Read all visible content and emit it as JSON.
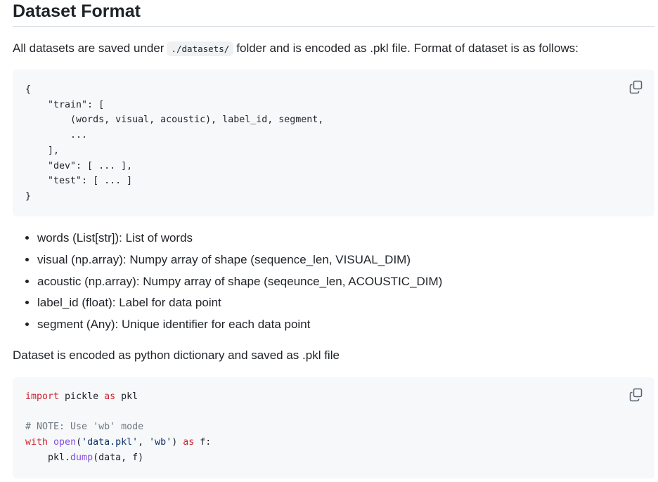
{
  "heading": "Dataset Format",
  "intro": {
    "before": "All datasets are saved under",
    "path": "./datasets/",
    "after": "folder and is encoded as .pkl file. Format of dataset is as follows:"
  },
  "code_block_1": {
    "lines": [
      "{",
      "    \"train\": [",
      "        (words, visual, acoustic), label_id, segment,",
      "        ...",
      "    ],",
      "    \"dev\": [ ... ],",
      "    \"test\": [ ... ]",
      "}"
    ]
  },
  "fields": [
    "words (List[str]): List of words",
    "visual (np.array): Numpy array of shape (sequence_len, VISUAL_DIM)",
    "acoustic (np.array): Numpy array of shape (seqeunce_len, ACOUSTIC_DIM)",
    "label_id (float): Label for data point",
    "segment (Any): Unique identifier for each data point"
  ],
  "encoding_note": "Dataset is encoded as python dictionary and saved as .pkl file",
  "code_block_2": {
    "kw_import": "import",
    "module": " pickle ",
    "kw_as": "as",
    "alias": " pkl",
    "comment": "# NOTE: Use 'wb' mode",
    "kw_with": "with",
    "fn_open": "open",
    "open_args_pre": "(",
    "str_file": "'data.pkl'",
    "comma": ", ",
    "str_mode": "'wb'",
    "open_args_post": ") ",
    "kw_as2": "as",
    "with_tail": " f:",
    "dump_indent": "    pkl.",
    "fn_dump": "dump",
    "dump_args": "(data, f)"
  },
  "icons": {
    "copy": "copy-icon"
  }
}
